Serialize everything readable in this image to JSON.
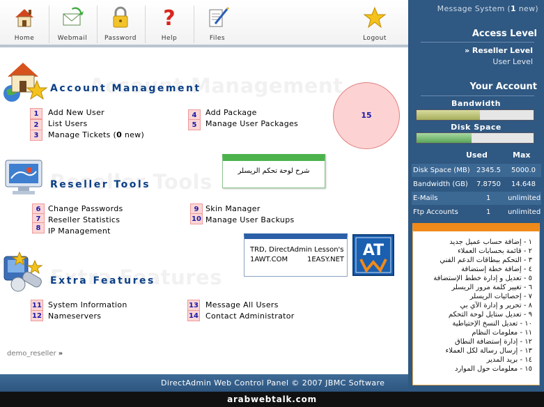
{
  "toolbar": {
    "home": "Home",
    "webmail": "Webmail",
    "password": "Password",
    "help": "Help",
    "files": "Files",
    "logout": "Logout"
  },
  "sections": {
    "account": {
      "title": "Account Management",
      "ghost": "Account Management",
      "items": [
        {
          "num": "1",
          "label": "Add New User"
        },
        {
          "num": "2",
          "label": "List Users"
        },
        {
          "num": "3",
          "label": "Manage Tickets (",
          "bold": "0",
          "suffix": " new)"
        },
        {
          "num": "4",
          "label": "Add Package"
        },
        {
          "num": "5",
          "label": "Manage User Packages"
        }
      ]
    },
    "reseller": {
      "title": "Reseller Tools",
      "ghost": "Reseller Tools",
      "items": [
        {
          "num": "6",
          "label": "Change Passwords"
        },
        {
          "num": "7",
          "label": "Reseller Statistics"
        },
        {
          "num": "8",
          "label": "IP Management"
        },
        {
          "num": "9",
          "label": "Skin Manager"
        },
        {
          "num": "10",
          "label": "Manage User Backups"
        }
      ]
    },
    "extra": {
      "title": "Extra Features",
      "ghost": "Extra Features",
      "items": [
        {
          "num": "11",
          "label": "System Information"
        },
        {
          "num": "12",
          "label": "Nameservers"
        },
        {
          "num": "13",
          "label": "Message All Users"
        },
        {
          "num": "14",
          "label": "Contact Administrator"
        }
      ]
    }
  },
  "circle_num": "15",
  "green_box_text": "شرح لوحة تحكم الريسلر",
  "trd_box": {
    "line1": "TRD, DirectAdmin Lesson's",
    "line2a": "1AWT.COM",
    "line2b": "1EASY.NET"
  },
  "logo_letters": "AT",
  "user_crumb": "demo_reseller",
  "footer": "DirectAdmin Web Control Panel © 2007 JBMC Software",
  "watermark": "arabwebtalk.com",
  "right": {
    "msg_prefix": "Message System (",
    "msg_count": "1",
    "msg_suffix": " new)",
    "access_level_title": "Access Level",
    "level_reseller": "» Reseller Level",
    "level_user": "User Level",
    "your_account_title": "Your Account",
    "bandwidth_label": "Bandwidth",
    "diskspace_label": "Disk Space",
    "bandwidth_fill": 0.54,
    "diskspace_fill": 0.47,
    "stats_header_used": "Used",
    "stats_header_max": "Max",
    "stats": [
      {
        "label": "Disk Space (MB)",
        "used": "2345.5",
        "max": "5000.0"
      },
      {
        "label": "Bandwidth (GB)",
        "used": "7.8750",
        "max": "14.648"
      },
      {
        "label": "E-Mails",
        "used": "1",
        "max": "unlimited"
      },
      {
        "label": "Ftp Accounts",
        "used": "1",
        "max": "unlimited"
      }
    ],
    "legend": [
      "١ - إضافة حساب عميل جديد",
      "٢ - قائمة بحسابات العملاء",
      "٣ - التحكم ببطاقات الدعم الفني",
      "٤ - إضافة خطة إستضافة",
      "٥ - تعديل و إدارة خطط الإستضافة",
      "٦ - تغيير كلمة مرور الريسلر",
      "٧ - إحصائيات الريسلر",
      "٨ - تحرير و إدارة الآي بي",
      "٩ - تعديل ستايل لوحة التحكم",
      "١٠ - تعديل النسخ الإحتياطية",
      "١١ - معلومات النظام",
      "١٢ - إدارة إستضافة النطاق",
      "١٣ - إرسال رسالة لكل العملاء",
      "١٤ - بريد المدير",
      "١٥ - معلومات حول الموارد"
    ]
  },
  "colors": {
    "panel_blue": "#2f5882",
    "title_blue": "#0b3f86",
    "num_pink": "#fbd6d6",
    "orange": "#f08a1a",
    "green": "#4cb34c"
  }
}
